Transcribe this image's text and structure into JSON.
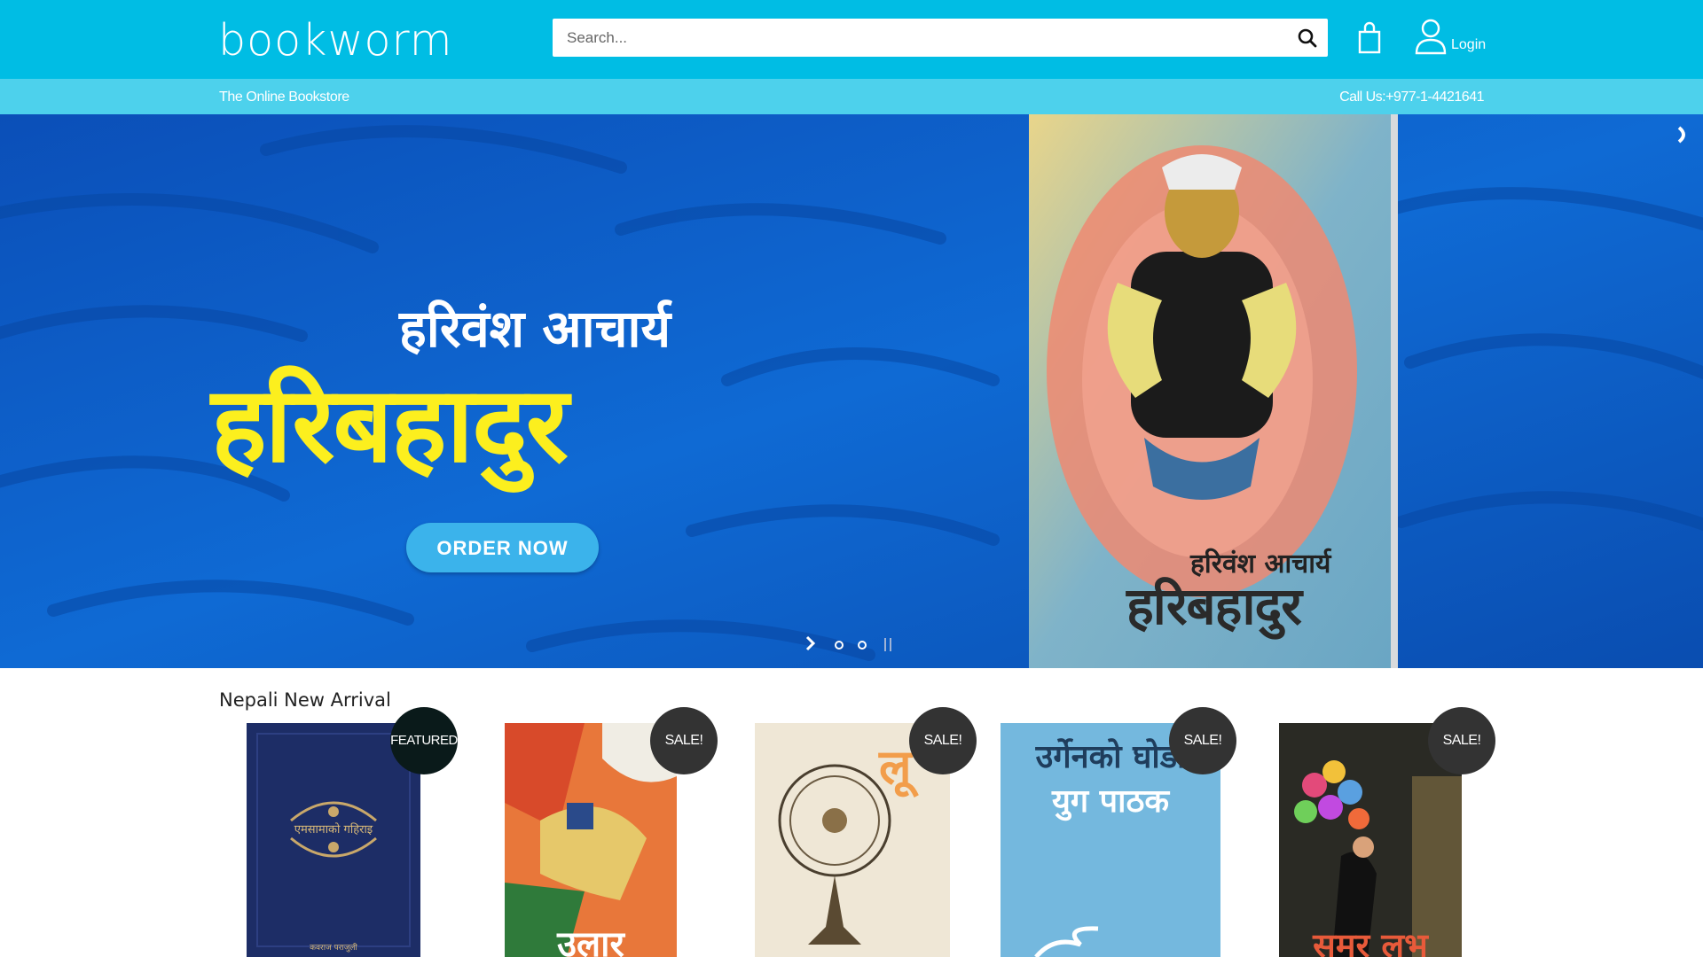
{
  "header": {
    "logo": "bookworm",
    "search_placeholder": "Search...",
    "login_label": "Login",
    "tagline": "The Online Bookstore",
    "phone": "Call Us:+977-1-4421641"
  },
  "banner": {
    "author": "हरिवंश आचार्य",
    "title": "हरिबहादुर",
    "cta": "ORDER NOW",
    "cover_author": "हरिवंश आचार्य",
    "cover_title": "हरिबहादुर",
    "slides_count": 2
  },
  "section": {
    "title": "Nepali New Arrival"
  },
  "products": [
    {
      "badge": "FEATURED",
      "cover_text": "एमसामाको गहिराइ",
      "cover_footer": "कवराज पराजुली"
    },
    {
      "badge": "SALE!",
      "cover_text": "उलार"
    },
    {
      "badge": "SALE!",
      "cover_text": "लू"
    },
    {
      "badge": "SALE!",
      "cover_text": "उर्गेनको घोडा",
      "cover_subtext": "युग पाठक"
    },
    {
      "badge": "SALE!",
      "cover_text": "समर लभ"
    }
  ],
  "colors": {
    "header": "#00bde4",
    "subbar": "#4dd1ec",
    "banner": "#0d5ec9",
    "banner_title": "#fcef1e",
    "badge_dark": "#333333",
    "badge_featured": "#0a1a1a"
  },
  "icons": {
    "search": "search-icon",
    "cart": "shopping-bag-icon",
    "login": "user-icon",
    "slide_next": "chevron-right-icon",
    "pause": "pause-icon"
  }
}
